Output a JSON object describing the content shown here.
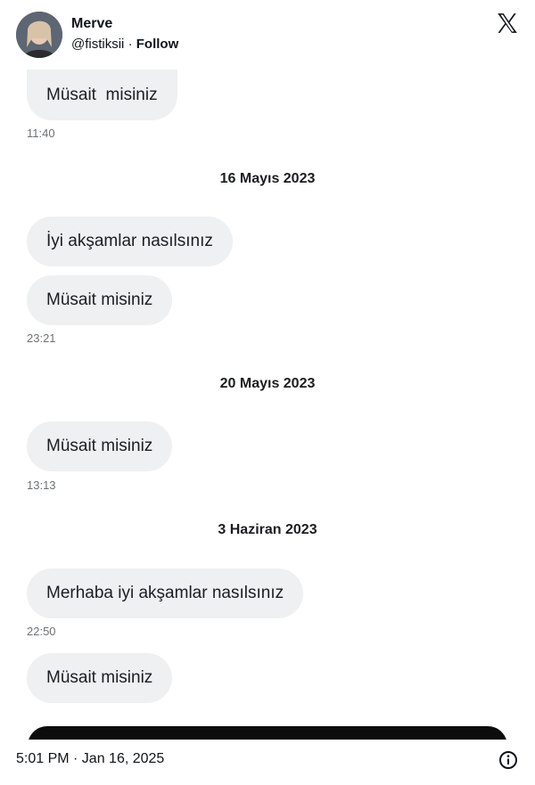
{
  "header": {
    "name": "Merve",
    "handle": "@fistiksii",
    "separator": "·",
    "follow": "Follow"
  },
  "messages": [
    {
      "text": "Müsait  misiniz",
      "time": "11:40"
    },
    {
      "date": "16 Mayıs 2023"
    },
    {
      "text": "İyi akşamlar nasılsınız"
    },
    {
      "text": "Müsait misiniz",
      "time": "23:21"
    },
    {
      "date": "20 Mayıs 2023"
    },
    {
      "text": "Müsait misiniz",
      "time": "13:13"
    },
    {
      "date": "3 Haziran 2023"
    },
    {
      "text": "Merhaba iyi akşamlar nasılsınız",
      "time": "22:50"
    },
    {
      "text": "Müsait misiniz"
    }
  ],
  "footer": {
    "timestamp": "5:01 PM · Jan 16, 2025"
  },
  "icons": {
    "logo": "x-logo-icon",
    "info": "info-icon"
  }
}
